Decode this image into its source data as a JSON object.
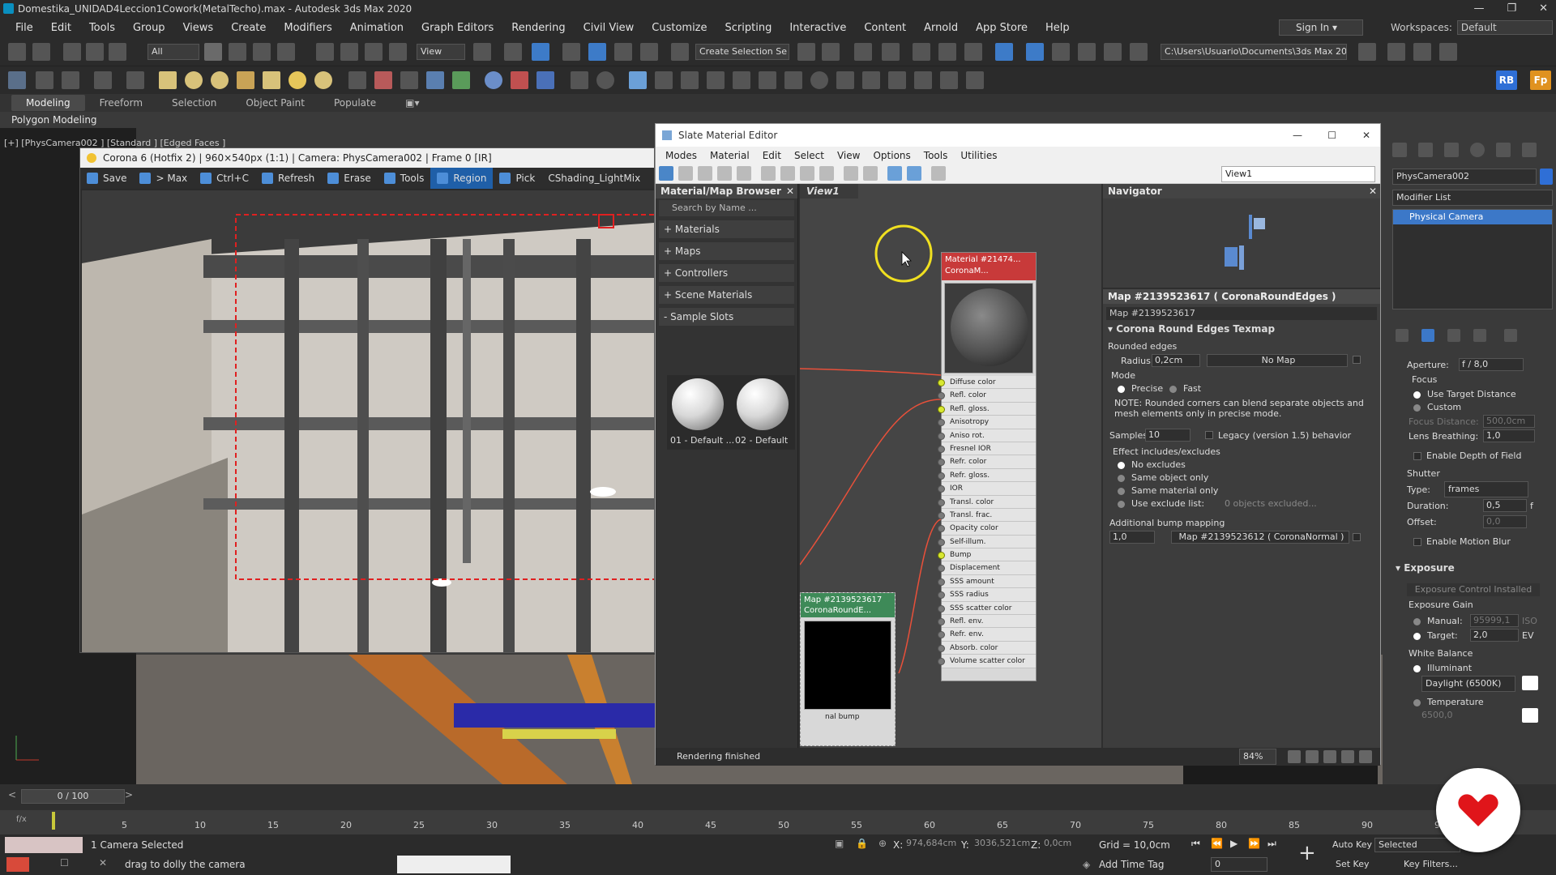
{
  "window": {
    "title": "Domestika_UNIDAD4Leccion1Cowork(MetalTecho).max - Autodesk 3ds Max 2020"
  },
  "menu": [
    "File",
    "Edit",
    "Tools",
    "Group",
    "Views",
    "Create",
    "Modifiers",
    "Animation",
    "Graph Editors",
    "Rendering",
    "Civil View",
    "Customize",
    "Scripting",
    "Interactive",
    "Content",
    "Arnold",
    "App Store",
    "Help"
  ],
  "account": {
    "sign_in": "Sign In",
    "workspaces_label": "Workspaces:",
    "workspace": "Default"
  },
  "toolbar": {
    "filter": "All",
    "view": "View",
    "selection_set": "Create Selection Se",
    "path": "C:\\Users\\Usuario\\Documents\\3ds Max 2020",
    "rb": "RB",
    "fp": "Fp"
  },
  "ribbon": {
    "tabs": [
      "Modeling",
      "Freeform",
      "Selection",
      "Object Paint",
      "Populate"
    ],
    "subtitle": "Polygon Modeling"
  },
  "viewport": {
    "label": "[+] [PhysCamera002 ] [Standard ] [Edged Faces ]"
  },
  "frame": {
    "title": "Corona 6 (Hotfix 2) | 960×540px (1:1) | Camera: PhysCamera002 | Frame 0 [IR]",
    "buttons": [
      "Save",
      "> Max",
      "Ctrl+C",
      "Refresh",
      "Erase",
      "Tools",
      "Region",
      "Pick",
      "CShading_LightMix"
    ]
  },
  "slate": {
    "title": "Slate Material Editor",
    "menu": [
      "Modes",
      "Material",
      "Edit",
      "Select",
      "View",
      "Options",
      "Tools",
      "Utilities"
    ],
    "view_dropdown": "View1",
    "browser": {
      "title": "Material/Map Browser",
      "search": "Search by Name ...",
      "groups": [
        "+ Materials",
        "+ Maps",
        "+ Controllers",
        "+ Scene Materials",
        "- Sample Slots"
      ],
      "samples": [
        "01 - Default ...",
        "02 - Default"
      ]
    },
    "view_tab": "View1",
    "material_node": {
      "title": "Material #21474...",
      "type": "CoronaM...",
      "slots": [
        "Diffuse color",
        "Refl. color",
        "Refl. gloss.",
        "Anisotropy",
        "Aniso rot.",
        "Fresnel IOR",
        "Refr. color",
        "Refr. gloss.",
        "IOR",
        "Transl. color",
        "Transl. frac.",
        "Opacity color",
        "Self-illum.",
        "Bump",
        "Displacement",
        "SSS amount",
        "SSS radius",
        "SSS scatter color",
        "Refl. env.",
        "Refr. env.",
        "Absorb. color",
        "Volume scatter color"
      ],
      "connected": [
        0,
        2,
        13
      ]
    },
    "map_node": {
      "title": "Map #2139523617",
      "type": "CoronaRoundE...",
      "output": "nal bump"
    },
    "navigator": {
      "title": "Navigator"
    },
    "params": {
      "header": "Map #2139523617  ( CoronaRoundEdges )",
      "name": "Map #2139523617",
      "rollout": "Corona Round Edges Texmap",
      "rounded_edges": "Rounded edges",
      "radius_label": "Radius:",
      "radius": "0,2cm",
      "no_map": "No Map",
      "mode_label": "Mode",
      "mode_precise": "Precise",
      "mode_fast": "Fast",
      "note": "NOTE: Rounded corners can blend separate objects and mesh elements only in precise mode.",
      "samples_label": "Samples:",
      "samples": "10",
      "legacy": "Legacy (version 1.5) behavior",
      "effect_label": "Effect includes/excludes",
      "effect_options": [
        "No excludes",
        "Same object only",
        "Same material only",
        "Use exclude list:"
      ],
      "excluded": "0 objects excluded...",
      "bump_label": "Additional bump mapping",
      "bump_amount": "1,0",
      "bump_map": "Map #2139523612  ( CoronaNormal )"
    },
    "status": "Rendering finished",
    "zoom": "84%"
  },
  "command_panel": {
    "object_name": "PhysCamera002",
    "modifier_list": "Modifier List",
    "stack_item": "Physical Camera",
    "aperture_label": "Aperture:",
    "aperture_value": "f / 8,0",
    "focus_label": "Focus",
    "use_target": "Use Target Distance",
    "custom": "Custom",
    "focus_distance_label": "Focus Distance:",
    "focus_distance": "500,0cm",
    "lens_breathing_label": "Lens Breathing:",
    "lens_breathing": "1,0",
    "enable_dof": "Enable Depth of Field",
    "shutter_label": "Shutter",
    "type_label": "Type:",
    "type_value": "frames",
    "duration_label": "Duration:",
    "duration": "0,5",
    "duration_unit": "f",
    "offset_label": "Offset:",
    "offset": "0,0",
    "motion_blur": "Enable Motion Blur",
    "exposure_title": "Exposure",
    "exposure_control": "Exposure Control Installed",
    "exposure_gain": "Exposure Gain",
    "manual_label": "Manual:",
    "manual_value": "95999,1",
    "manual_unit": "ISO",
    "target_label": "Target:",
    "target_value": "2,0",
    "target_unit": "EV",
    "white_balance": "White Balance",
    "illuminant": "Illuminant",
    "illuminant_value": "Daylight (6500K)",
    "temperature": "Temperature",
    "temperature_value": "6500,0"
  },
  "timeline": {
    "frame": "0 / 100",
    "ticks": [
      "5",
      "10",
      "15",
      "20",
      "25",
      "30",
      "35",
      "40",
      "45",
      "50",
      "55",
      "60",
      "65",
      "70",
      "75",
      "80",
      "85",
      "90",
      "95"
    ]
  },
  "status": {
    "selection": "1 Camera Selected",
    "prompt": "drag to dolly the camera",
    "x_label": "X:",
    "x": "974,684cm",
    "y_label": "Y:",
    "y": "3036,521cm",
    "z_label": "Z:",
    "z": "0,0cm",
    "grid": "Grid = 10,0cm",
    "add_time_tag": "Add Time Tag",
    "auto_key": "Auto Key",
    "selected": "Selected",
    "set_key": "Set Key",
    "key_filters": "Key Filters...",
    "frame_field": "0"
  }
}
